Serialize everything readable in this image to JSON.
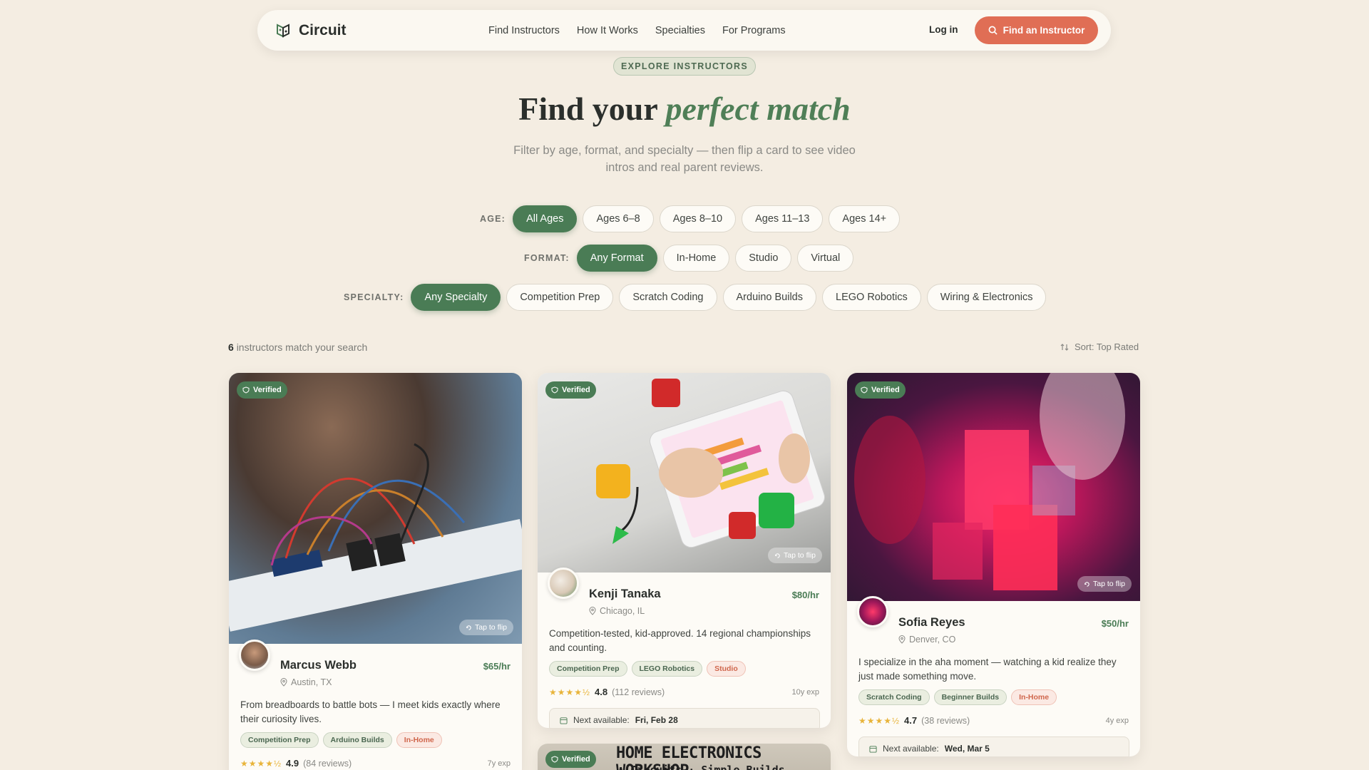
{
  "nav": {
    "brand": "Circuit",
    "links": [
      "Find Instructors",
      "How It Works",
      "Specialties",
      "For Programs"
    ],
    "login": "Log in",
    "cta": "Find an Instructor"
  },
  "hero": {
    "eyebrow": "EXPLORE INSTRUCTORS",
    "title_plain": "Find your",
    "title_accent": "perfect match",
    "subtitle": "Filter by age, format, and specialty — then flip a card to see video intros and real parent reviews."
  },
  "filters": {
    "age": {
      "label": "AGE:",
      "options": [
        "All Ages",
        "Ages 6–8",
        "Ages 8–10",
        "Ages 11–13",
        "Ages 14+"
      ],
      "selected": "All Ages"
    },
    "format": {
      "label": "FORMAT:",
      "options": [
        "Any Format",
        "In-Home",
        "Studio",
        "Virtual"
      ],
      "selected": "Any Format"
    },
    "specialty": {
      "label": "SPECIALTY:",
      "options": [
        "Any Specialty",
        "Competition Prep",
        "Scratch Coding",
        "Arduino Builds",
        "LEGO Robotics",
        "Wiring & Electronics"
      ],
      "selected": "Any Specialty"
    }
  },
  "results": {
    "count": "6",
    "count_suffix": "instructors match your search",
    "sort": "Sort: Top Rated"
  },
  "cards": [
    {
      "badge": "Verified",
      "flip": "Tap to flip",
      "name": "Marcus Webb",
      "price": "$65/hr",
      "location": "Austin, TX",
      "bio": "From breadboards to battle bots — I meet kids exactly where their curiosity lives.",
      "tags": [
        "Competition Prep",
        "Arduino Builds",
        "In-Home"
      ],
      "stars": "★★★★½",
      "rating": "4.9",
      "reviews": "(84 reviews)",
      "exp": "7y exp"
    },
    {
      "badge": "Verified",
      "flip": "Tap to flip",
      "name": "Kenji Tanaka",
      "price": "$80/hr",
      "location": "Chicago, IL",
      "bio": "Competition-tested, kid-approved. 14 regional championships and counting.",
      "tags": [
        "Competition Prep",
        "LEGO Robotics",
        "Studio"
      ],
      "stars": "★★★★½",
      "rating": "4.8",
      "reviews": "(112 reviews)",
      "exp": "10y exp",
      "avail_label": "Next available:",
      "avail_value": "Fri, Feb 28"
    },
    {
      "badge": "Verified",
      "flip": "Tap to flip",
      "name": "Sofia Reyes",
      "price": "$50/hr",
      "location": "Denver, CO",
      "bio": "I specialize in the aha moment — watching a kid realize they just made something move.",
      "tags": [
        "Scratch Coding",
        "Beginner Builds",
        "In-Home"
      ],
      "stars": "★★★★½",
      "rating": "4.7",
      "reviews": "(38 reviews)",
      "exp": "4y exp",
      "avail_label": "Next available:",
      "avail_value": "Wed, Mar 5"
    },
    {
      "badge": "Verified",
      "banner": "HOME ELECTRONICS WORKSHOP",
      "banner_sub": "Circuits · Simple Builds"
    }
  ],
  "colors": {
    "accent_green": "#4a7c55",
    "cta_coral": "#e06e55",
    "background": "#f4ede2"
  }
}
